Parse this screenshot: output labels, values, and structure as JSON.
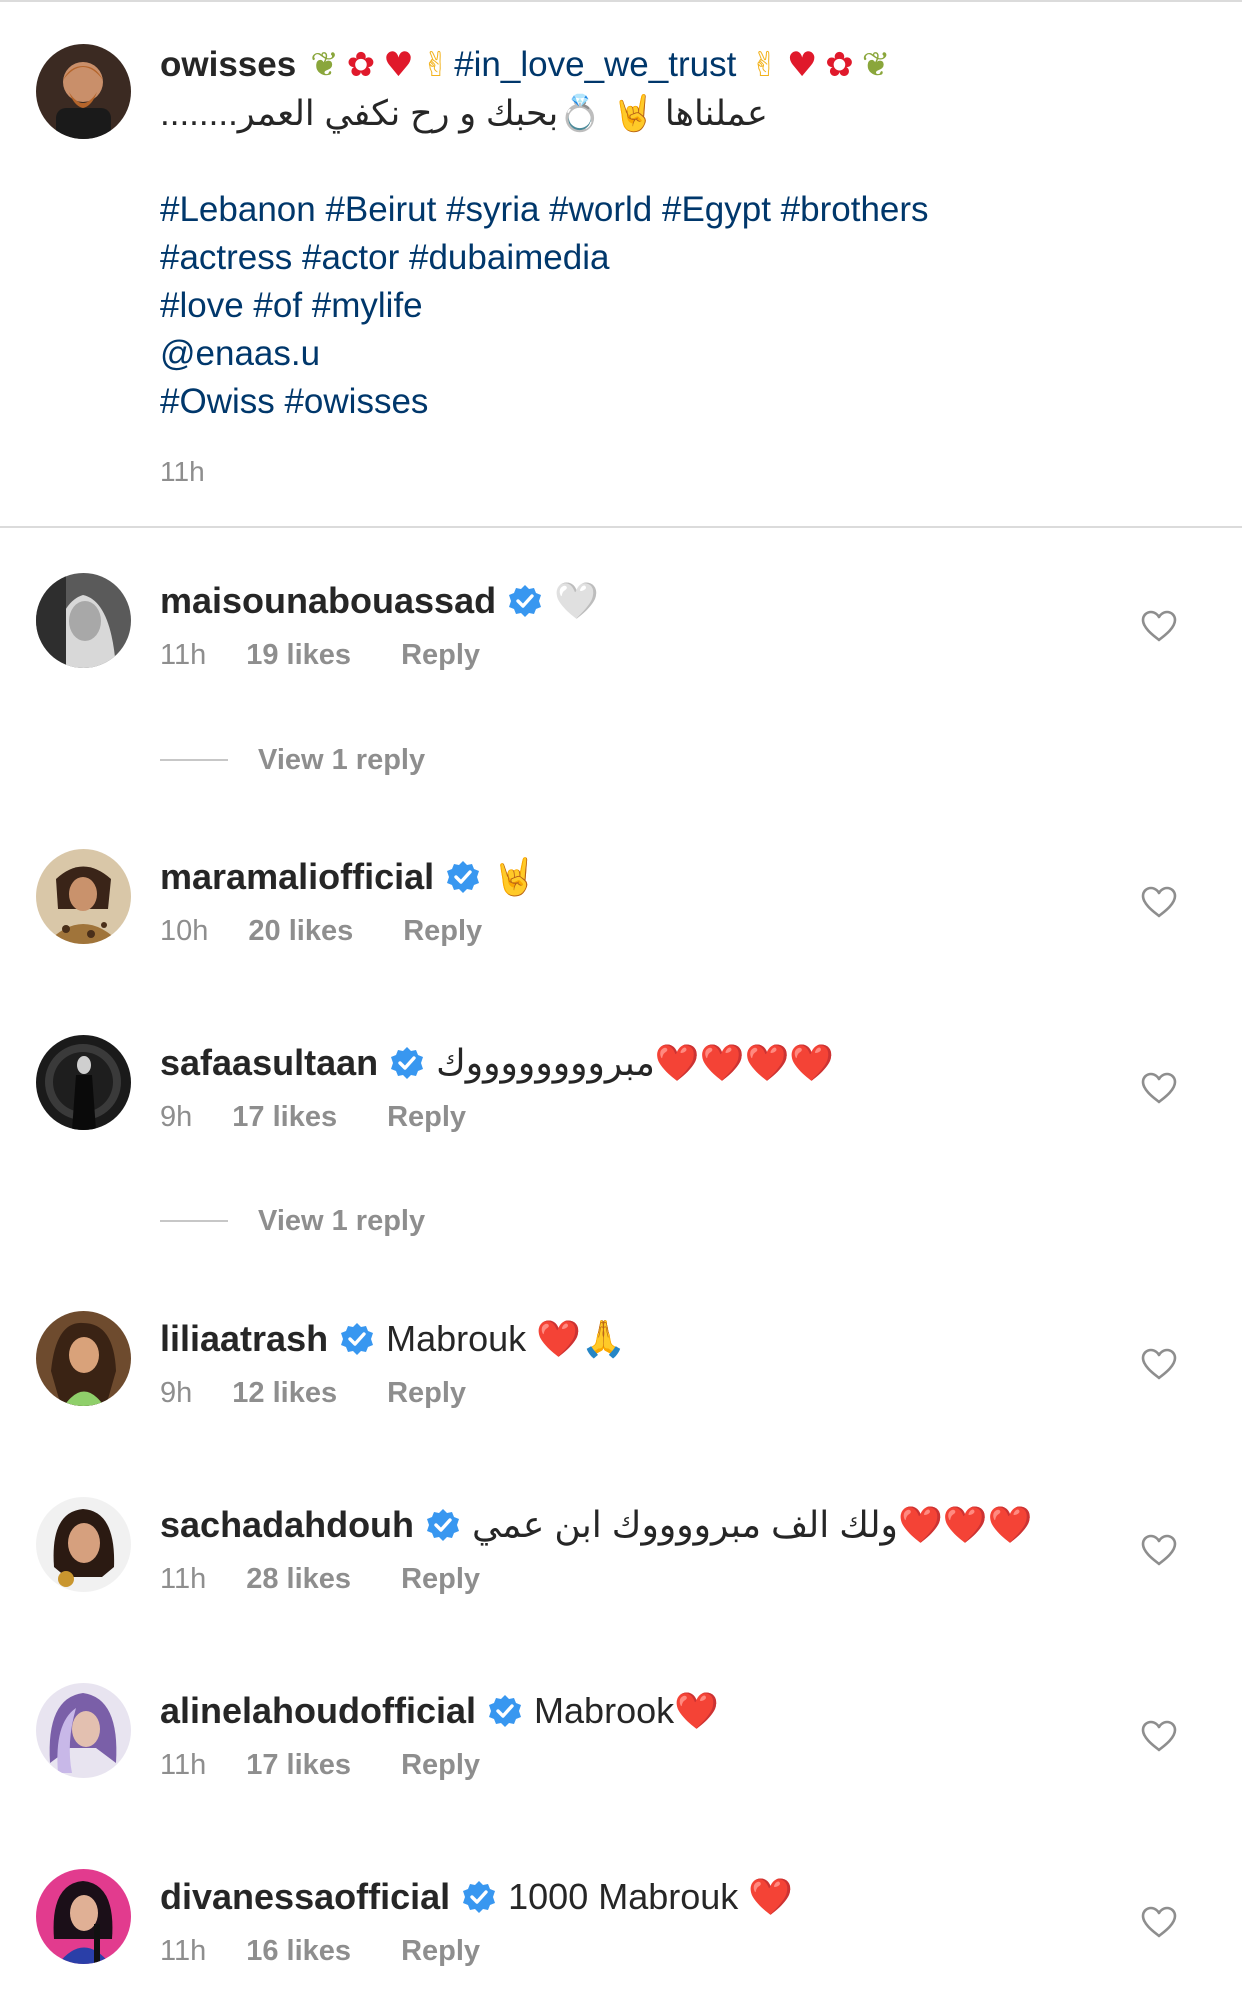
{
  "post": {
    "username": "owisses",
    "hashtag_main": "#in_love_we_trust",
    "arabic_line": "عملناها 🤘 💍بحبك و رح نكفي العمر........",
    "tags": [
      "#Lebanon #Beirut #syria #world #Egypt #brothers",
      "#actress #actor #dubaimedia",
      "#love #of #mylife",
      "@enaas.u",
      "#Owiss #owisses"
    ],
    "time": "11h"
  },
  "colors": {
    "link": "#00376b",
    "muted": "#8e8e8e",
    "verified": "#3897f0",
    "divider": "#dbdbdb"
  },
  "comments": [
    {
      "username": "maisounabouassad",
      "verified": true,
      "text": "🤍",
      "time": "11h",
      "likes": "19 likes",
      "reply": "Reply",
      "view_reply": "View 1 reply"
    },
    {
      "username": "maramaliofficial",
      "verified": true,
      "text": "🤘",
      "time": "10h",
      "likes": "20 likes",
      "reply": "Reply"
    },
    {
      "username": "safaasultaan",
      "verified": true,
      "text": "مبرووووووووك❤️❤️❤️❤️",
      "time": "9h",
      "likes": "17 likes",
      "reply": "Reply",
      "view_reply": "View 1 reply"
    },
    {
      "username": "liliaatrash",
      "verified": true,
      "text": "Mabrouk ❤️🙏",
      "time": "9h",
      "likes": "12 likes",
      "reply": "Reply"
    },
    {
      "username": "sachadahdouh",
      "verified": true,
      "text": "ولك الف مبرووووك ابن عمي❤️❤️❤️",
      "time": "11h",
      "likes": "28 likes",
      "reply": "Reply"
    },
    {
      "username": "alinelahoudofficial",
      "verified": true,
      "text": "Mabrook❤️",
      "time": "11h",
      "likes": "17 likes",
      "reply": "Reply"
    },
    {
      "username": "divanessaofficial",
      "verified": true,
      "text": "1000 Mabrouk ❤️",
      "time": "11h",
      "likes": "16 likes",
      "reply": "Reply"
    }
  ],
  "icons": {
    "heart": "heart-outline-icon",
    "verified": "verified-badge-icon"
  }
}
